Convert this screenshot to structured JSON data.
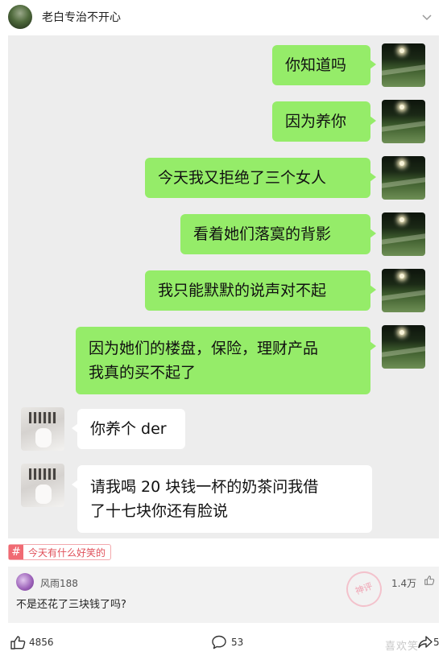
{
  "header": {
    "title": "老白专治不开心"
  },
  "chat": {
    "messages": [
      {
        "side": "right",
        "lines": [
          "你知道吗"
        ]
      },
      {
        "side": "right",
        "lines": [
          "因为养你"
        ]
      },
      {
        "side": "right",
        "lines": [
          "今天我又拒绝了三个女人"
        ]
      },
      {
        "side": "right",
        "lines": [
          "看着她们落寞的背影"
        ]
      },
      {
        "side": "right",
        "lines": [
          "我只能默默的说声对不起"
        ]
      },
      {
        "side": "right",
        "lines": [
          "因为她们的楼盘，保险，理财产品",
          "我真的买不起了"
        ]
      },
      {
        "side": "left",
        "lines": [
          "你养个 der"
        ]
      },
      {
        "side": "left",
        "lines": [
          "请我喝 20 块钱一杯的奶茶问我借",
          "了十七块你还有脸说"
        ]
      }
    ]
  },
  "topic": {
    "icon": "#",
    "label": "今天有什么好笑的"
  },
  "comment": {
    "username": "风雨188",
    "likes": "1.4万",
    "text": "不是还花了三块钱了吗?",
    "stamp": "神评"
  },
  "actions": {
    "like_count": "4856",
    "comment_count": "53",
    "share_count": "5"
  },
  "watermark": "喜欢笑"
}
